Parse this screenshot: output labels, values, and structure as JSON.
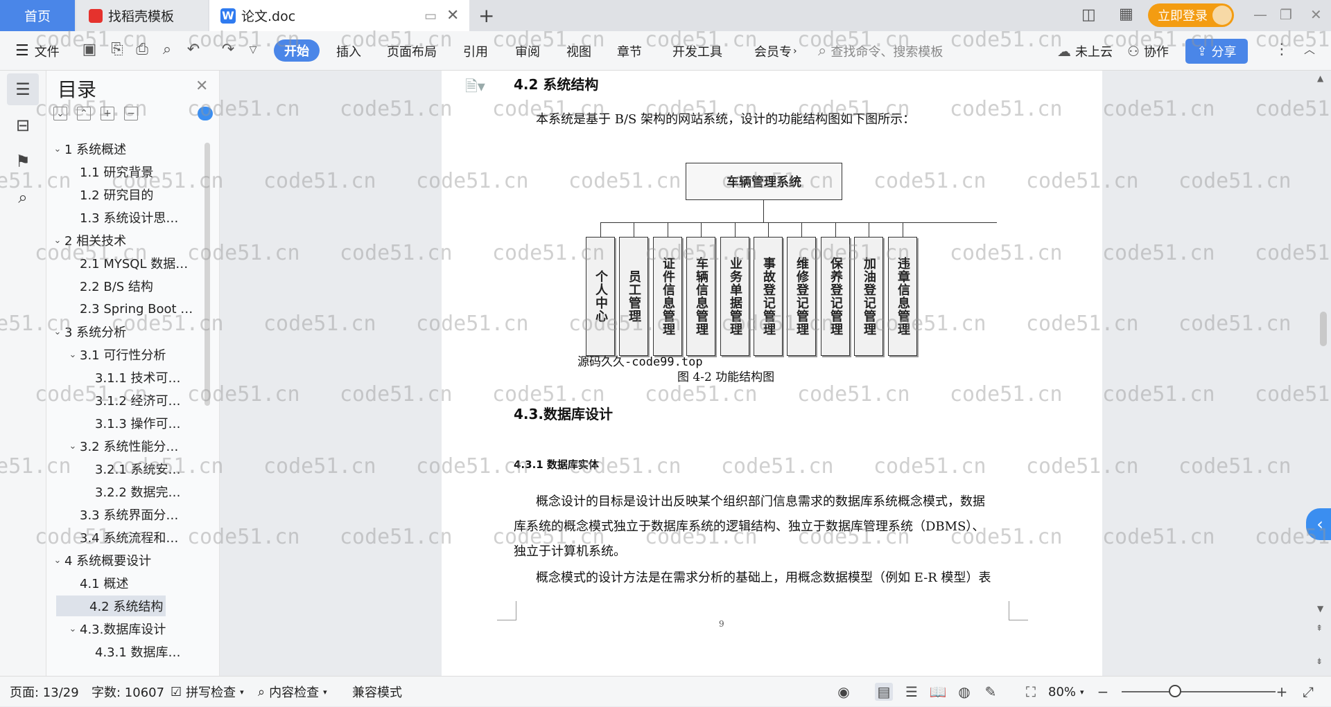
{
  "tabs": {
    "home": "首页",
    "template": "找稻壳模板",
    "doc": "论文.doc",
    "login": "立即登录"
  },
  "menu": {
    "file": "文件",
    "start": "开始",
    "insert": "插入",
    "layout": "页面布局",
    "reference": "引用",
    "review": "审阅",
    "view": "视图",
    "chapter": "章节",
    "dev": "开发工具",
    "member": "会员专",
    "search_placeholder": "查找命令、搜索模板",
    "cloud": "未上云",
    "collab": "协作",
    "share": "分享"
  },
  "toc": {
    "title": "目录",
    "items": [
      {
        "label": "1 系统概述",
        "level": 1,
        "expanded": true
      },
      {
        "label": "1.1  研究背景",
        "level": 2
      },
      {
        "label": "1.2 研究目的",
        "level": 2
      },
      {
        "label": "1.3 系统设计思…",
        "level": 2
      },
      {
        "label": "2 相关技术",
        "level": 1,
        "expanded": true
      },
      {
        "label": "2.1 MYSQL 数据…",
        "level": 2
      },
      {
        "label": "2.2 B/S 结构",
        "level": 2
      },
      {
        "label": "2.3 Spring Boot …",
        "level": 2
      },
      {
        "label": "3 系统分析",
        "level": 1,
        "expanded": true
      },
      {
        "label": "3.1 可行性分析",
        "level": 2,
        "expanded": true
      },
      {
        "label": "3.1.1 技术可…",
        "level": 3
      },
      {
        "label": "3.1.2 经济可…",
        "level": 3
      },
      {
        "label": "3.1.3 操作可…",
        "level": 3
      },
      {
        "label": "3.2 系统性能分…",
        "level": 2,
        "expanded": true
      },
      {
        "label": "3.2.1  系统安…",
        "level": 3
      },
      {
        "label": "3.2.2  数据完…",
        "level": 3
      },
      {
        "label": "3.3 系统界面分…",
        "level": 2
      },
      {
        "label": "3.4 系统流程和…",
        "level": 2
      },
      {
        "label": "4 系统概要设计",
        "level": 1,
        "expanded": true
      },
      {
        "label": "4.1 概述",
        "level": 2
      },
      {
        "label": "4.2 系统结构",
        "level": 2,
        "active": true
      },
      {
        "label": "4.3.数据库设计",
        "level": 2,
        "expanded": true
      },
      {
        "label": "4.3.1 数据库…",
        "level": 3
      }
    ]
  },
  "doc": {
    "heading_42": "4.2 系统结构",
    "intro": "本系统是基于 B/S 架构的网站系统，设计的功能结构图如下图所示：",
    "diagram_root": "车辆管理系统",
    "diagram_children": [
      "个人中心",
      "员工管理",
      "证件信息管理",
      "车辆信息管理",
      "业务单据管理",
      "事故登记管理",
      "维修登记管理",
      "保养登记管理",
      "加油登记管理",
      "违章信息管理"
    ],
    "overlay_text": "源码久久-code99.top",
    "caption": "图 4-2 功能结构图",
    "heading_43": "4.3.数据库设计",
    "heading_431": "4.3.1 数据库实体",
    "para1_line1": "概念设计的目标是设计出反映某个组织部门信息需求的数据库系统概念模式，数据",
    "para1_line2": "库系统的概念模式独立于数据库系统的逻辑结构、独立于数据库管理系统（DBMS）、",
    "para1_line3": "独立于计算机系统。",
    "para2_line1": "概念模式的设计方法是在需求分析的基础上，用概念数据模型（例如 E-R 模型）表",
    "page_number": "9"
  },
  "watermark": "code51.cn",
  "status": {
    "page": "页面: 13/29",
    "words": "字数: 10607",
    "spell": "拼写检查",
    "content": "内容检查",
    "compat": "兼容模式",
    "zoom": "80%"
  },
  "colors": {
    "accent": "#4a86e8",
    "login": "#f39c12"
  }
}
